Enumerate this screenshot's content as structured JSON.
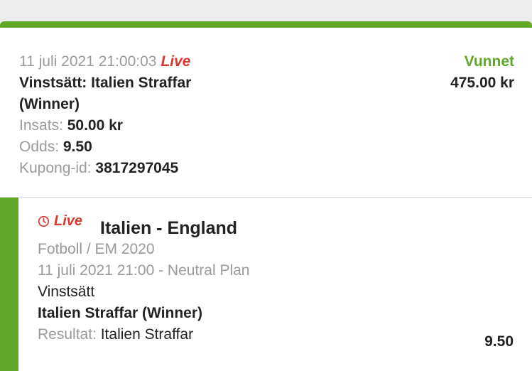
{
  "bet": {
    "datetime": "11 juli 2021 21:00:03",
    "live_label": "Live",
    "selection": "Vinstsätt: Italien Straffar (Winner)",
    "stake_label": "Insats:",
    "stake_value": "50.00 kr",
    "odds_label": "Odds:",
    "odds_value": "9.50",
    "coupon_label": "Kupong-id:",
    "coupon_value": "3817297045",
    "status": "Vunnet",
    "payout": "475.00 kr"
  },
  "event": {
    "live_label": "Live",
    "match": "Italien - England",
    "category": "Fotboll / EM 2020",
    "datetime_venue": "11 juli 2021 21:00 -  Neutral Plan",
    "market": "Vinstsätt",
    "selection": "Italien Straffar (Winner)",
    "odds": "9.50",
    "result_label": "Resultat:",
    "result_value": "Italien Straffar"
  },
  "colors": {
    "accent_green": "#5fa829",
    "live_red": "#d9382c",
    "muted_text": "#9a9a9a",
    "dark_text": "#222222"
  },
  "icons": {
    "live": "clock-icon"
  }
}
